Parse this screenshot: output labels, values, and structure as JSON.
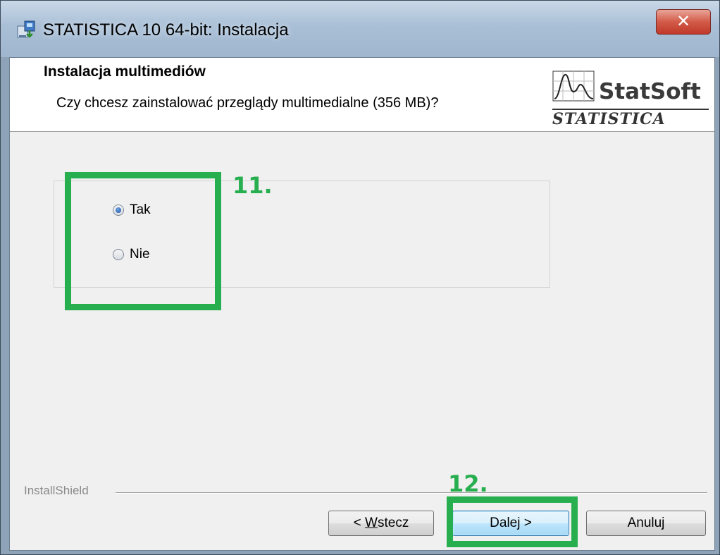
{
  "window": {
    "title": "STATISTICA 10 64-bit: Instalacja",
    "close_glyph": "✕"
  },
  "header": {
    "title": "Instalacja multimediów",
    "subtitle": "Czy chcesz zainstalować przeglądy multimedialne (356 MB)?",
    "logo_brand": "StatSoft",
    "logo_sub": "STATISTICA"
  },
  "options": {
    "selected": "Tak",
    "items": [
      {
        "label": "Tak",
        "checked": true
      },
      {
        "label": "Nie",
        "checked": false
      }
    ]
  },
  "annotations": {
    "step_options": "11.",
    "step_next": "12.",
    "highlight_color": "#27ae4f"
  },
  "footer": {
    "brand": "InstallShield",
    "back_prefix": "< ",
    "back_mnemonic": "W",
    "back_rest": "stecz",
    "next_label": "Dalej >",
    "cancel_label": "Anuluj"
  }
}
